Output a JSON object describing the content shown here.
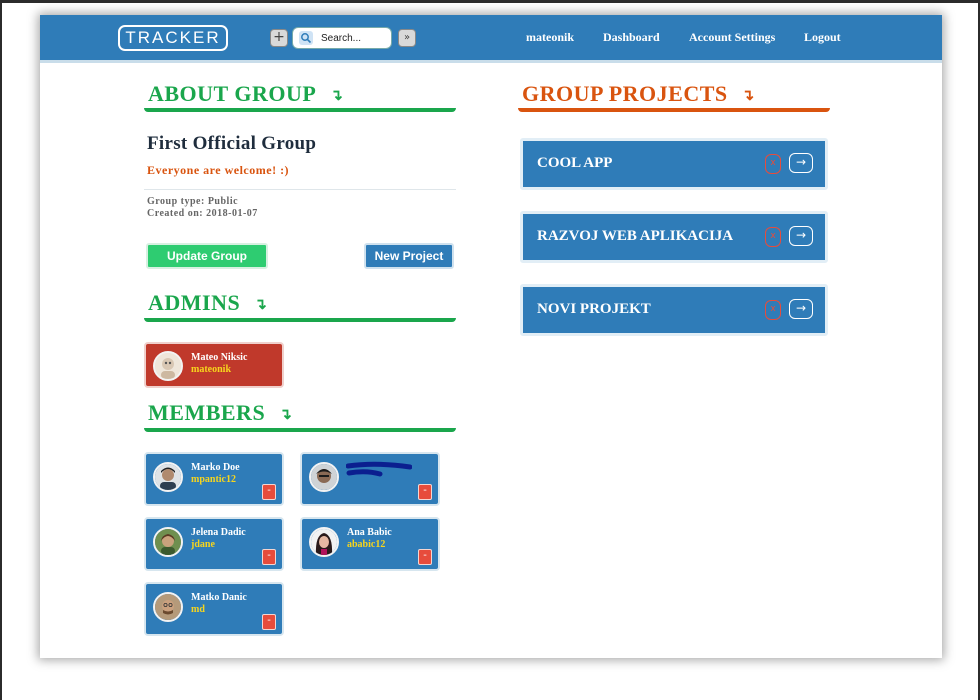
{
  "navbar": {
    "logo": "TRACKER",
    "plus_label": "+",
    "search_placeholder": "Search...",
    "go_label": "»",
    "links": [
      "mateonik",
      "Dashboard",
      "Account Settings",
      "Logout"
    ]
  },
  "about": {
    "heading": "ABOUT GROUP",
    "arrow": "↴",
    "group_name": "First Official Group",
    "description": "Everyone are welcome! :)",
    "group_type": "Group type: Public",
    "created_on": "Created on: 2018-01-07",
    "update_button": "Update Group",
    "new_project_button": "New Project"
  },
  "admins": {
    "heading": "ADMINS",
    "arrow": "↴",
    "items": [
      {
        "name": "Mateo Niksic",
        "username": "mateonik"
      }
    ]
  },
  "members": {
    "heading": "MEMBERS",
    "arrow": "↴",
    "remove_label": "-",
    "items": [
      {
        "name": "Marko Doe",
        "username": "mpantic12"
      },
      {
        "name": "",
        "username": ""
      },
      {
        "name": "Jelena Dadic",
        "username": "jdane"
      },
      {
        "name": "Ana Babic",
        "username": "ababic12"
      },
      {
        "name": "Matko Danic",
        "username": "md"
      }
    ]
  },
  "projects": {
    "heading": "GROUP PROJECTS",
    "arrow": "↴",
    "delete_label": "x",
    "open_label": "→",
    "items": [
      {
        "name": "COOL APP"
      },
      {
        "name": "RAZVOJ WEB APLIKACIJA"
      },
      {
        "name": "NOVI PROJEKT"
      }
    ]
  },
  "colors": {
    "navbar": "#2f7cb8",
    "green_accent": "#1aa64c",
    "orange_accent": "#d9540f",
    "admin_card": "#c0392b",
    "member_card": "#2f7cb8",
    "username_text": "#f7d51d"
  }
}
